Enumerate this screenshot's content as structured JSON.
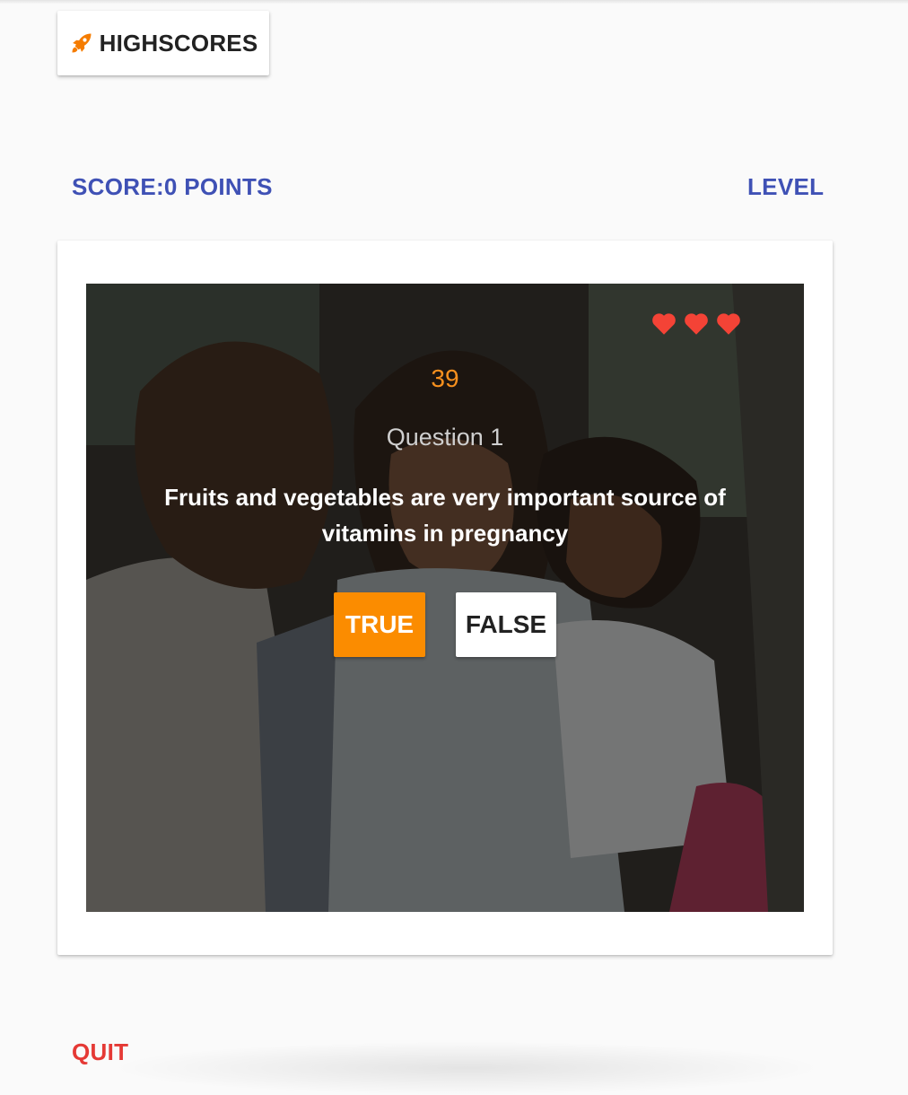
{
  "highscores": {
    "label": "HIGHSCORES",
    "icon": "rocket-icon",
    "icon_color": "#f57c00"
  },
  "status": {
    "score_label": "SCORE:0 POINTS",
    "level_label": "LEVEL"
  },
  "quiz": {
    "lives": 3,
    "heart_color": "#f44336",
    "timer": "39",
    "question_number": "Question 1",
    "question_text": "Fruits and vegetables are very important source of vitamins in pregnancy",
    "true_label": "TRUE",
    "false_label": "FALSE"
  },
  "quit_label": "QUIT",
  "colors": {
    "accent": "#3f51b5",
    "orange": "#fb8c00",
    "danger": "#e53935"
  }
}
